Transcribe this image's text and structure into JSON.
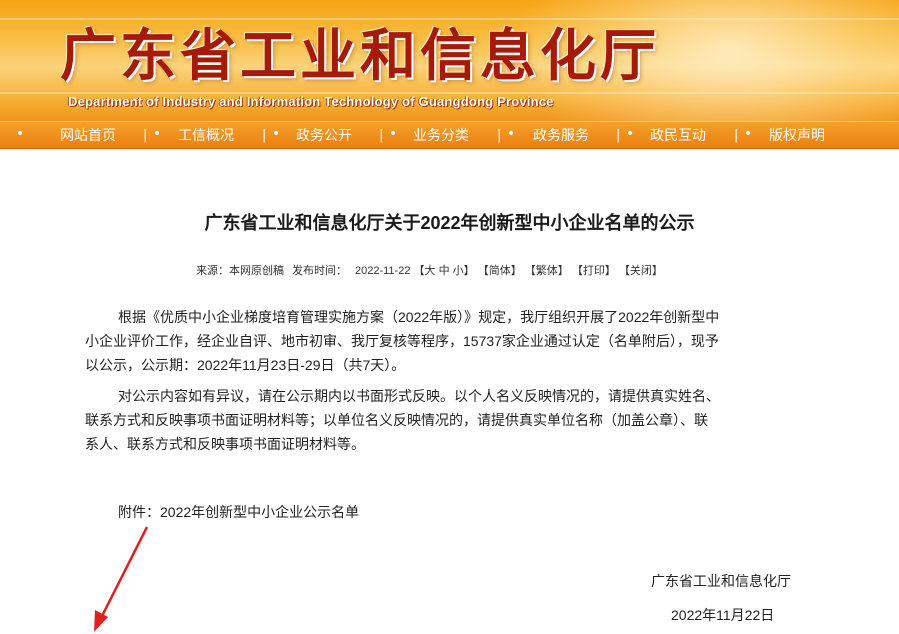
{
  "header": {
    "title_cn": "广东省工业和信息化厅",
    "title_en": "Department of Industry and Information Technology of Guangdong Province"
  },
  "nav": {
    "items": [
      "网站首页",
      "工信概况",
      "政务公开",
      "业务分类",
      "政务服务",
      "政民互动",
      "版权声明"
    ],
    "dot": "•",
    "sep": "|"
  },
  "article": {
    "title": "广东省工业和信息化厅关于2022年创新型中小企业名单的公示",
    "meta": {
      "source": "来源：本网原创稿",
      "publish_label": "发布时间：",
      "date": "2022-11-22",
      "font_open": "【",
      "font_large": "大",
      "font_medium": "中",
      "font_small": "小",
      "font_close": "】",
      "simplified": "【简体】",
      "traditional": "【繁体】",
      "print": "【打印】",
      "close": "【关闭】"
    },
    "paragraph1": [
      "根据《优质中小企业梯度培育管理实施方案（2022年版）》规定，我厅组织开展了2022年创新型中",
      "小企业评价工作，经企业自评、地市初审、我厅复核等程序，15737家企业通过认定（名单附后），现予",
      "以公示，公示期：2022年11月23日-29日（共7天）。"
    ],
    "paragraph2": [
      "对公示内容如有异议，请在公示期内以书面形式反映。以个人名义反映情况的，请提供真实姓名、",
      "联系方式和反映事项书面证明材料等；以单位名义反映情况的，请提供真实单位名称（加盖公章）、联",
      "系人、联系方式和反映事项书面证明材料等。"
    ],
    "attachment_label": "附件：",
    "attachment_link": "2022年创新型中小企业公示名单",
    "signature_org": "广东省工业和信息化厅",
    "signature_date": "2022年11月22日"
  },
  "colors": {
    "banner_orange": "#f6a312",
    "nav_orange": "#ec7f10",
    "title_red": "#a61a0a",
    "arrow_red": "#e02020"
  }
}
